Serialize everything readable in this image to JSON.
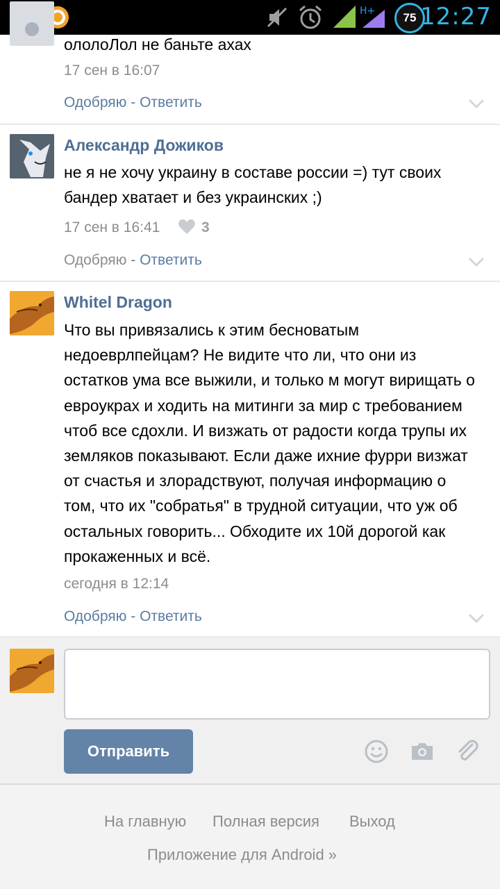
{
  "status_bar": {
    "time": "12:27",
    "battery": "75",
    "network": "H+",
    "icons": [
      "download-icon",
      "app-notification-icon",
      "mute-icon",
      "alarm-icon",
      "signal-icon",
      "battery-icon"
    ]
  },
  "comments": [
    {
      "author": "",
      "text": "ололоЛол не баньте ахах",
      "date": "17 сен в 16:07",
      "actions": {
        "approve": "Одобряю",
        "sep": " - ",
        "reply": "Ответить"
      }
    },
    {
      "author": "Александр Дожиков",
      "text_lines": [
        "не я не хочу украину в составе россии =) тут своих",
        "бандер хватает и без украинских ;)"
      ],
      "date": "17 сен в 16:41",
      "likes": "3",
      "actions": {
        "approve": "Одобряю",
        "sep": " - ",
        "reply": "Ответить"
      }
    },
    {
      "author": "Whitel Dragon",
      "text_lines": [
        "Что вы привязались к этим бесноватым",
        "недоеврлпейцам? Не видите что ли, что они из",
        "остатков ума все выжили, и только м могут вирищать о",
        "евроукрах и ходить на митинги за мир с требованием",
        "чтоб все сдохли. И визжать от радости когда трупы их",
        "земляков показывают. Если даже ихние фурри визжат",
        "от счастья и злорадствуют, получая информацию о",
        "том, что их \"собратья\" в трудной ситуации, что уж об",
        "остальных говорить... Обходите их 10й дорогой как",
        "прокаженных и всё."
      ],
      "date": "сегодня в 12:14",
      "actions": {
        "approve": "Одобряю",
        "sep": " - ",
        "reply": "Ответить"
      }
    }
  ],
  "reply": {
    "input_value": "",
    "send_label": "Отправить",
    "tools": [
      "smiley-icon",
      "camera-icon",
      "paperclip-icon"
    ]
  },
  "footer": {
    "home": "На главную",
    "full_version": "Полная версия",
    "logout": "Выход",
    "android_app": "Приложение для Android »"
  },
  "colors": {
    "link": "#5b7ca3",
    "author": "#4f6e94",
    "button": "#6383a8",
    "status_time": "#33b5e5"
  }
}
